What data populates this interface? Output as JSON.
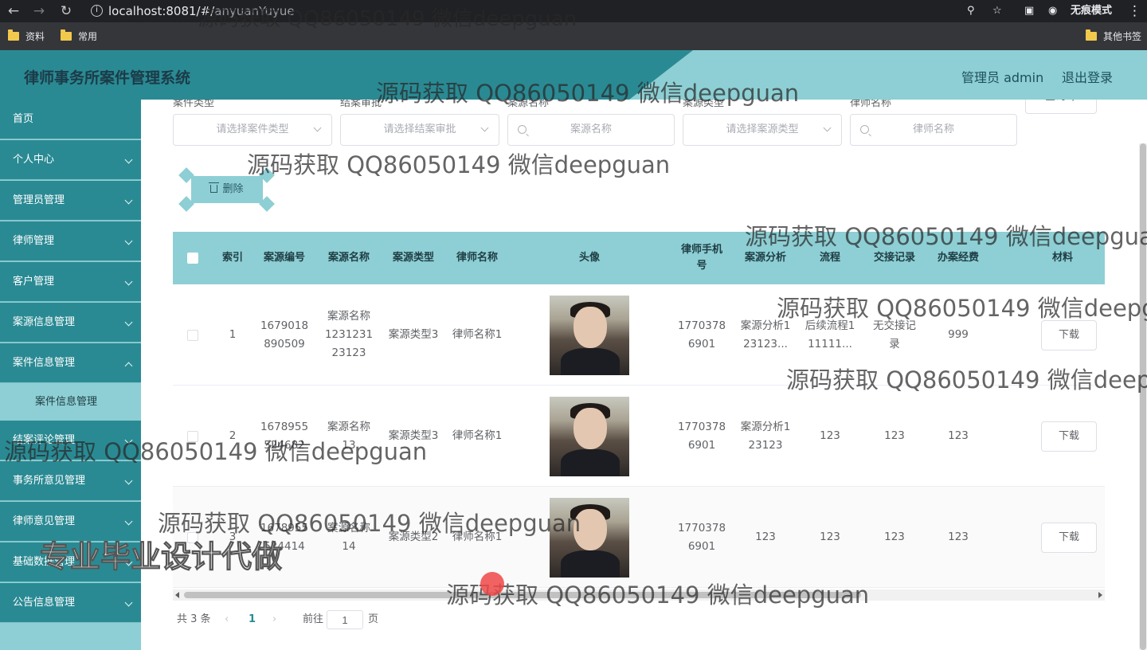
{
  "browser": {
    "url_host": "localhost:8081/#/",
    "url_path": "anyuanYuyue",
    "incognito_label": "无痕模式",
    "bookmarks": [
      "资料",
      "常用"
    ],
    "other_bookmarks": "其他书签"
  },
  "header": {
    "title": "律师事务所案件管理系统",
    "user_label": "管理员 admin",
    "logout": "退出登录"
  },
  "sidebar": {
    "items": [
      {
        "label": "首页",
        "chevron": false
      },
      {
        "label": "个人中心",
        "chevron": true
      },
      {
        "label": "管理员管理",
        "chevron": true
      },
      {
        "label": "律师管理",
        "chevron": true
      },
      {
        "label": "客户管理",
        "chevron": true
      },
      {
        "label": "案源信息管理",
        "chevron": true
      },
      {
        "label": "案件信息管理",
        "chevron": true
      },
      {
        "label": "结案评论管理",
        "chevron": true
      },
      {
        "label": "事务所意见管理",
        "chevron": true
      },
      {
        "label": "律师意见管理",
        "chevron": true
      },
      {
        "label": "基础数据管理",
        "chevron": true
      },
      {
        "label": "公告信息管理",
        "chevron": true
      }
    ],
    "active_sub": "案件信息管理"
  },
  "filters": [
    {
      "label": "案件类型",
      "placeholder": "请选择案件类型",
      "kind": "select"
    },
    {
      "label": "结案审批",
      "placeholder": "请选择结案审批",
      "kind": "select"
    },
    {
      "label": "案源名称",
      "placeholder": "案源名称",
      "kind": "search"
    },
    {
      "label": "案源类型",
      "placeholder": "请选择案源类型",
      "kind": "select"
    },
    {
      "label": "律师名称",
      "placeholder": "律师名称",
      "kind": "search"
    }
  ],
  "query_button": "查询",
  "delete_button": "删除",
  "table": {
    "columns": [
      "索引",
      "案源编号",
      "案源名称",
      "案源类型",
      "律师名称",
      "头像",
      "律师手机号",
      "案源分析",
      "流程",
      "交接记录",
      "办案经费",
      "材料"
    ],
    "rows": [
      {
        "index": "1",
        "code": "1679018890509",
        "name": "案源名称123123123123",
        "type": "案源类型3",
        "lawyer": "律师名称1",
        "phone": "17703786901",
        "analysis": "案源分析123123...",
        "flow": "后续流程111111...",
        "handover": "无交接记录",
        "funds": "999",
        "material": "下载"
      },
      {
        "index": "2",
        "code": "1678955524682",
        "name": "案源名称13",
        "type": "案源类型3",
        "lawyer": "律师名称1",
        "phone": "17703786901",
        "analysis": "案源分析123123",
        "flow": "123",
        "handover": "123",
        "funds": "123",
        "material": "下载"
      },
      {
        "index": "3",
        "code": "1678955524414",
        "name": "案源名称14",
        "type": "案源类型2",
        "lawyer": "律师名称1",
        "phone": "17703786901",
        "analysis": "123",
        "flow": "123",
        "handover": "123",
        "funds": "123",
        "material": "下载"
      }
    ]
  },
  "pagination": {
    "total": "共 3 条",
    "current": "1",
    "goto_prefix": "前往",
    "goto_value": "1",
    "goto_suffix": "页"
  },
  "watermark": {
    "text": "源码获取 QQ86050149 微信deepguan",
    "banner": "专业毕业设计代做"
  }
}
